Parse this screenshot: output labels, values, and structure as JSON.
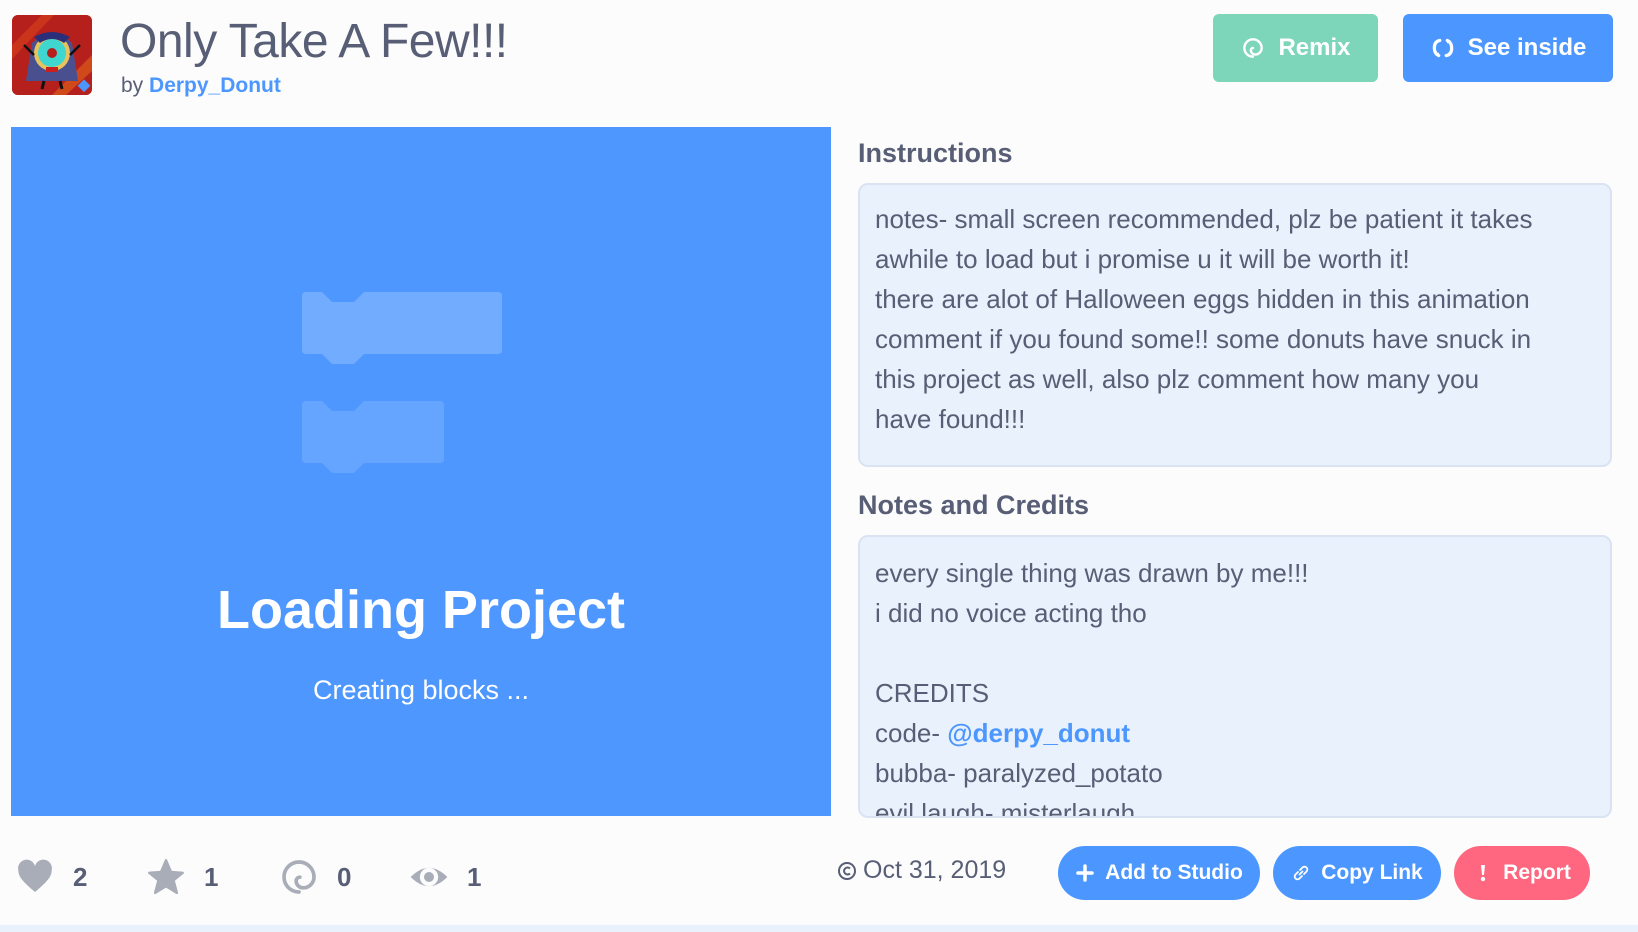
{
  "project": {
    "title": "Only Take A Few!!!",
    "by_label": "by",
    "author": "Derpy_Donut"
  },
  "header_buttons": {
    "remix_label": "Remix",
    "remix_icon": "remix-spiral-icon",
    "see_inside_label": "See inside",
    "see_inside_icon": "see-inside-arrows-icon"
  },
  "stage": {
    "loading_title": "Loading Project",
    "loading_status": "Creating blocks ..."
  },
  "instructions": {
    "heading": "Instructions",
    "lines": [
      "notes- small screen recommended, plz be patient it takes",
      "awhile to load but i promise u it will be worth it!",
      "there are alot of Halloween eggs hidden in this animation",
      "comment if you found some!! some donuts have snuck in",
      "this project as well, also plz comment how many you",
      "have found!!!"
    ]
  },
  "notes": {
    "heading": "Notes and Credits",
    "lines": [
      "every single thing was drawn by me!!!",
      "i did no voice acting tho",
      "",
      "CREDITS"
    ],
    "code_prefix": "code- ",
    "code_link": "@derpy_donut",
    "more_lines": [
      "bubba- paralyzed_potato",
      "evil laugh- misterlaugh"
    ]
  },
  "stats": {
    "loves": "2",
    "favorites": "1",
    "remixes": "0",
    "views": "1"
  },
  "footer": {
    "date": "Oct 31, 2019",
    "add_to_studio_label": "Add to Studio",
    "copy_link_label": "Copy Link",
    "report_label": "Report"
  },
  "colors": {
    "primary": "#4c97ff",
    "remix": "#7dd6b9",
    "report": "#ff6680",
    "text": "#575e75",
    "box_bg": "#e9f1fc"
  }
}
